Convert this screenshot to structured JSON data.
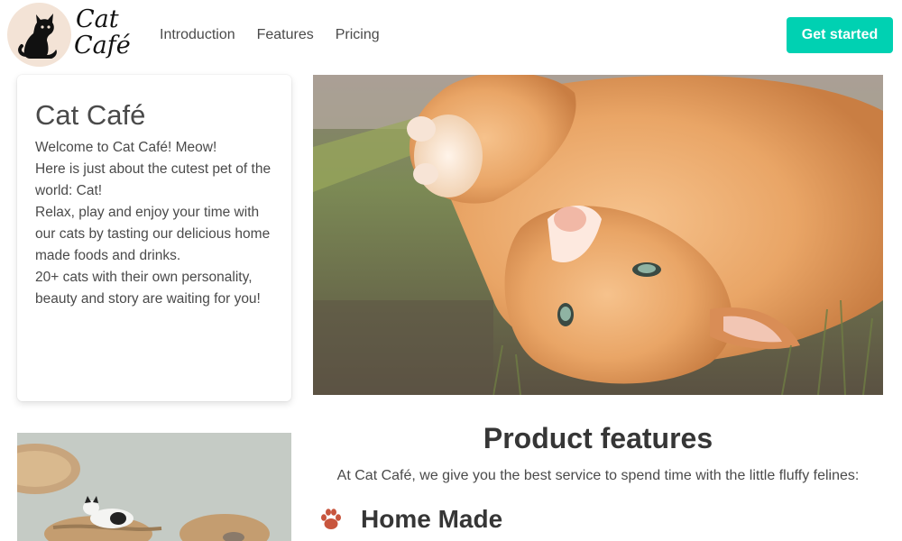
{
  "brand": {
    "line1": "Cat",
    "line2": "Café"
  },
  "nav": {
    "items": [
      "Introduction",
      "Features",
      "Pricing"
    ]
  },
  "cta": {
    "label": "Get started"
  },
  "intro": {
    "title": "Cat Café",
    "lines": [
      "Welcome to Cat Café! Meow!",
      "Here is just about the cutest pet of the world: Cat!",
      "Relax, play and enjoy your time with our cats by tasting our delicious home made foods and drinks.",
      "20+ cats with their own personality, beauty and story are waiting for you!"
    ]
  },
  "features": {
    "title": "Product features",
    "subtitle": "At Cat Café, we give you the best service to spend time with the little fluffy felines:",
    "items": [
      {
        "label": "Home Made",
        "icon": "paw-icon"
      }
    ]
  },
  "colors": {
    "accent": "#00d1b2",
    "paw": "#c8553d",
    "heading": "#363636",
    "text": "#4a4a4a"
  }
}
